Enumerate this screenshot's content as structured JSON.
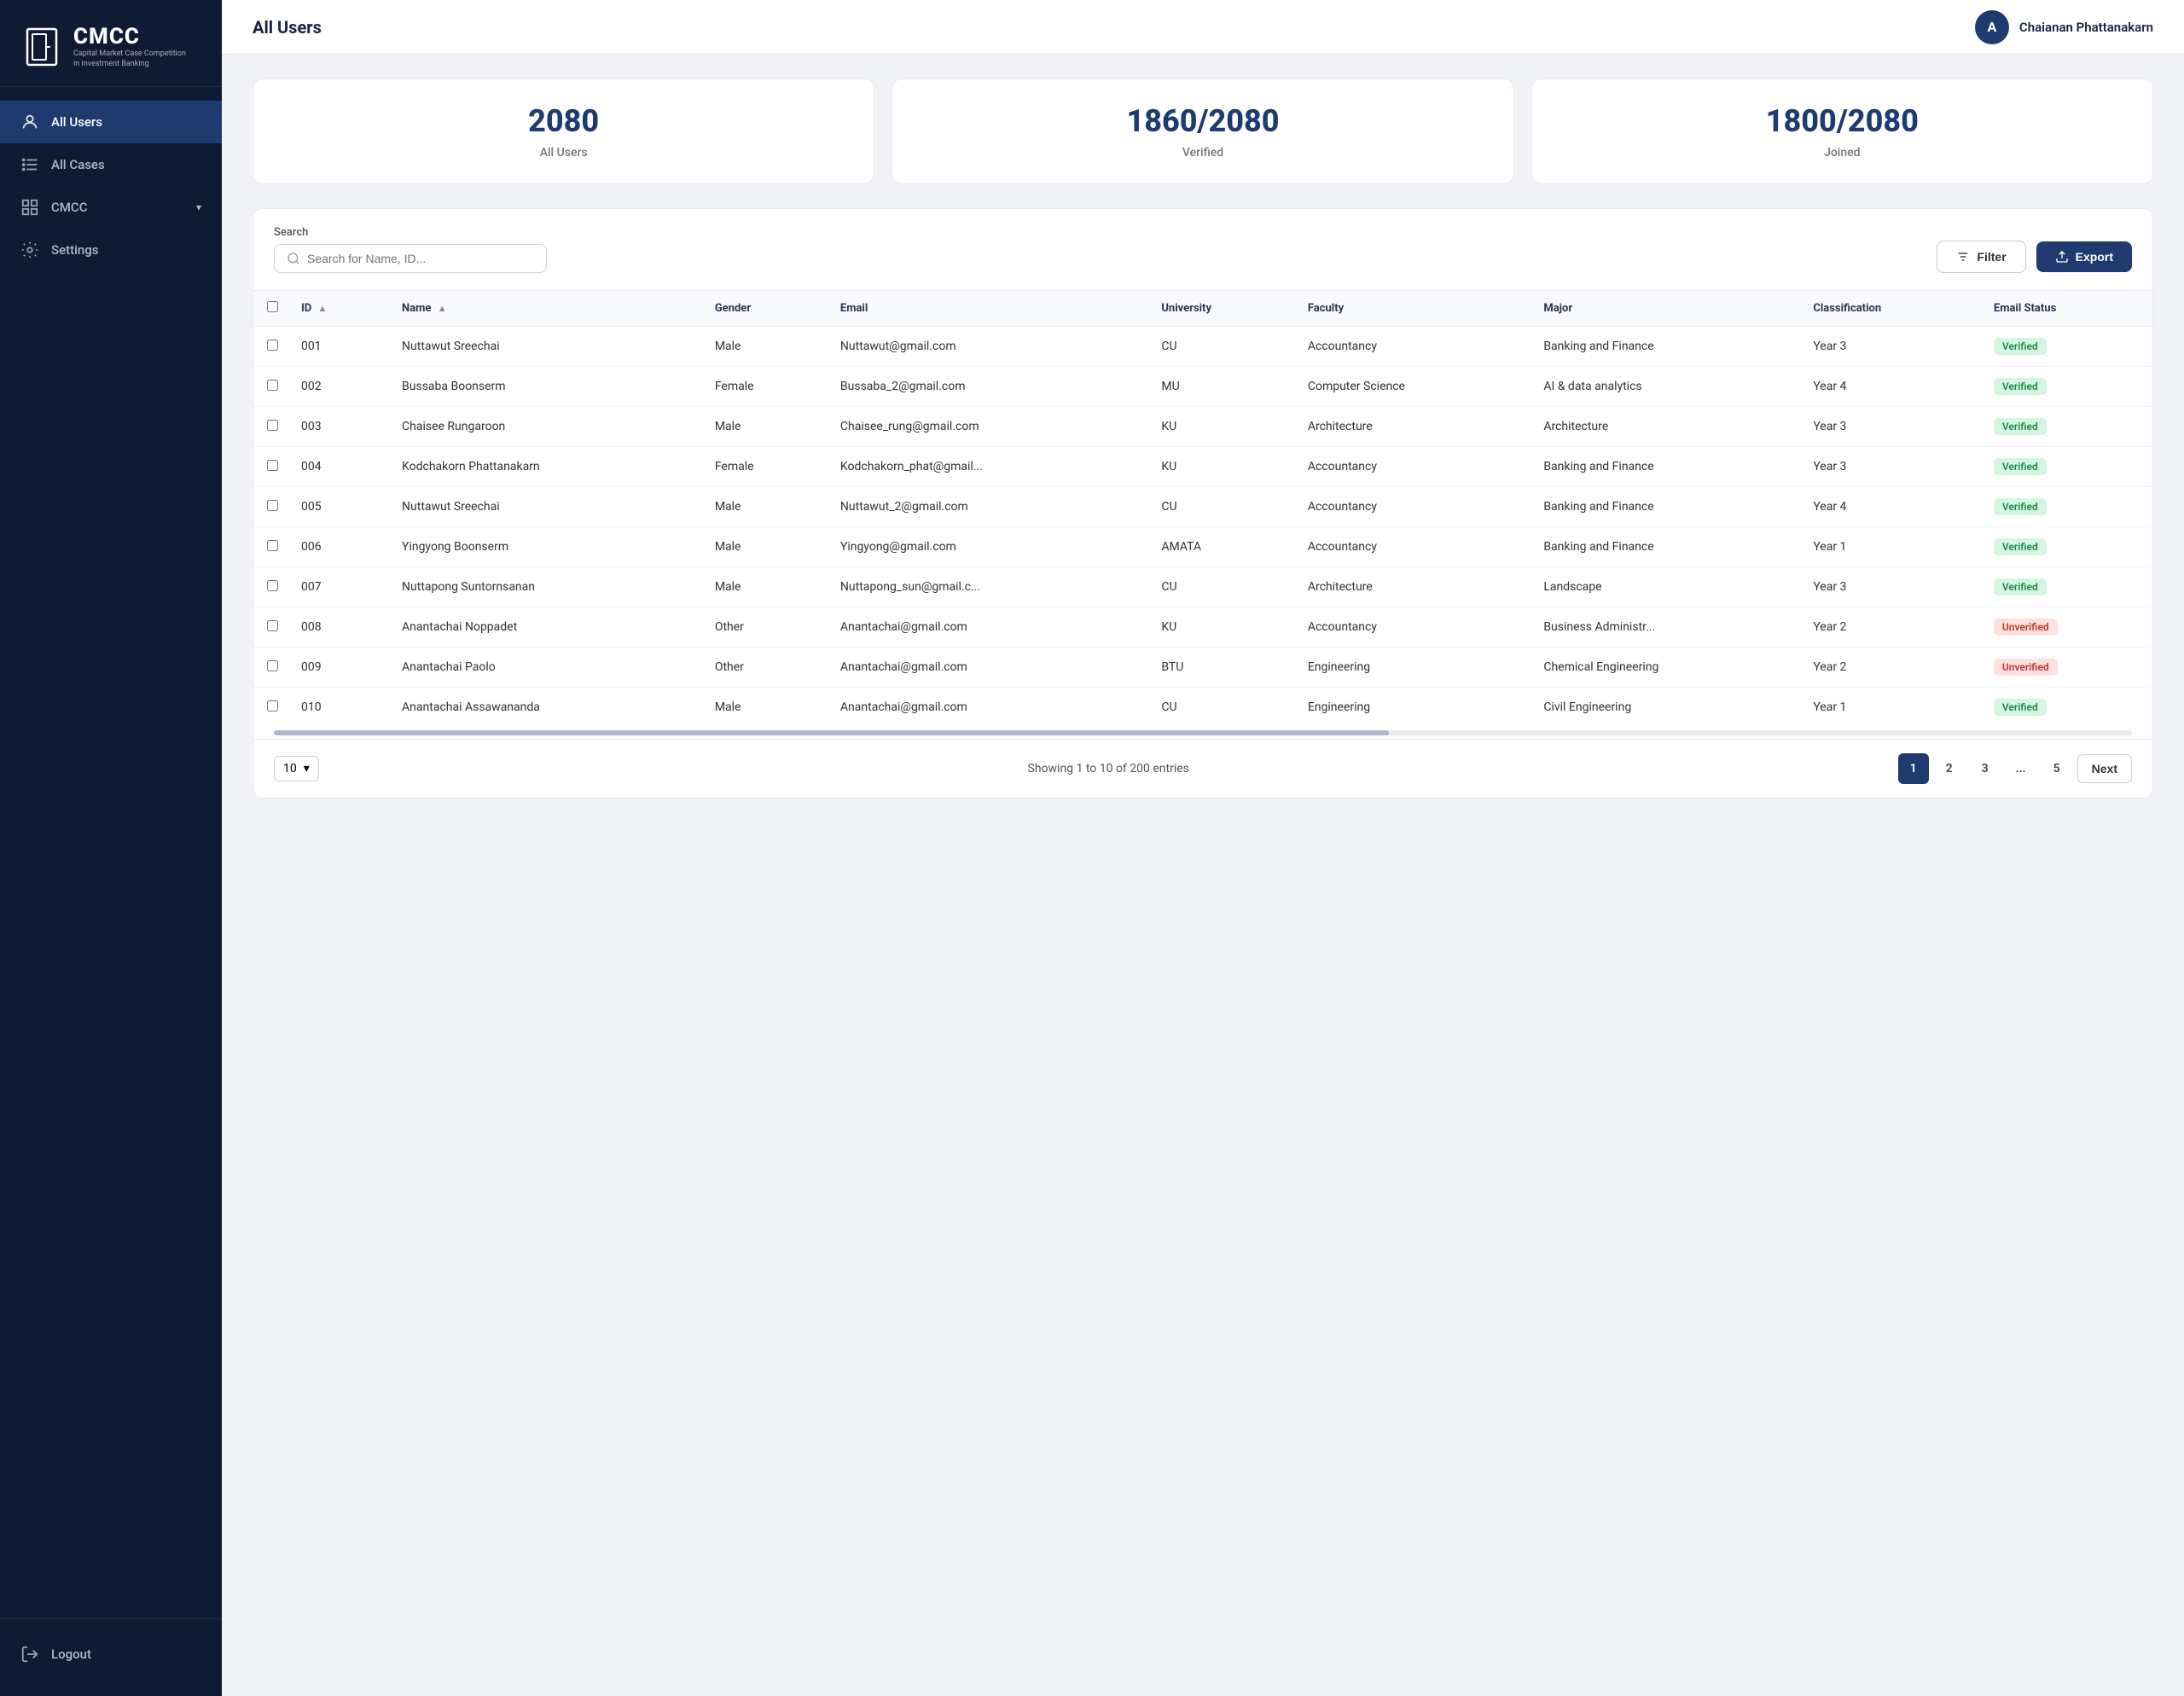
{
  "sidebar": {
    "logo": {
      "cmcc": "CMCC",
      "subtitle": "Capital Market Case Competition\nin Investment Banking"
    },
    "items": [
      {
        "id": "all-users",
        "label": "All Users",
        "icon": "user-icon",
        "active": true
      },
      {
        "id": "all-cases",
        "label": "All Cases",
        "icon": "list-icon",
        "active": false
      },
      {
        "id": "cmcc",
        "label": "CMCC",
        "icon": "grid-icon",
        "active": false,
        "hasArrow": true
      },
      {
        "id": "settings",
        "label": "Settings",
        "icon": "gear-icon",
        "active": false
      },
      {
        "id": "logout",
        "label": "Logout",
        "icon": "logout-icon",
        "active": false
      }
    ]
  },
  "header": {
    "title": "All Users",
    "user": {
      "avatar_letter": "A",
      "name": "Chaianan Phattanakarn"
    }
  },
  "stats": [
    {
      "value": "2080",
      "label": "All Users"
    },
    {
      "value": "1860/2080",
      "label": "Verified"
    },
    {
      "value": "1800/2080",
      "label": "Joined"
    }
  ],
  "toolbar": {
    "search_label": "Search",
    "search_placeholder": "Search for Name, ID...",
    "filter_label": "Filter",
    "export_label": "Export"
  },
  "table": {
    "columns": [
      "",
      "ID",
      "Name",
      "Gender",
      "Email",
      "University",
      "Faculty",
      "Major",
      "Classification",
      "Email Status"
    ],
    "rows": [
      {
        "id": "001",
        "name": "Nuttawut Sreechai",
        "gender": "Male",
        "email": "Nuttawut@gmail.com",
        "university": "CU",
        "faculty": "Accountancy",
        "major": "Banking and Finance",
        "classification": "Year 3",
        "status": "Verified"
      },
      {
        "id": "002",
        "name": "Bussaba Boonserm",
        "gender": "Female",
        "email": "Bussaba_2@gmail.com",
        "university": "MU",
        "faculty": "Computer Science",
        "major": "AI & data analytics",
        "classification": "Year 4",
        "status": "Verified"
      },
      {
        "id": "003",
        "name": "Chaisee Rungaroon",
        "gender": "Male",
        "email": "Chaisee_rung@gmail.com",
        "university": "KU",
        "faculty": "Architecture",
        "major": "Architecture",
        "classification": "Year 3",
        "status": "Verified"
      },
      {
        "id": "004",
        "name": "Kodchakorn Phattanakarn",
        "gender": "Female",
        "email": "Kodchakorn_phat@gmail...",
        "university": "KU",
        "faculty": "Accountancy",
        "major": "Banking and Finance",
        "classification": "Year 3",
        "status": "Verified"
      },
      {
        "id": "005",
        "name": "Nuttawut Sreechai",
        "gender": "Male",
        "email": "Nuttawut_2@gmail.com",
        "university": "CU",
        "faculty": "Accountancy",
        "major": "Banking and Finance",
        "classification": "Year 4",
        "status": "Verified"
      },
      {
        "id": "006",
        "name": "Yingyong Boonserm",
        "gender": "Male",
        "email": "Yingyong@gmail.com",
        "university": "AMATA",
        "faculty": "Accountancy",
        "major": "Banking and Finance",
        "classification": "Year 1",
        "status": "Verified"
      },
      {
        "id": "007",
        "name": "Nuttapong Suntornsanan",
        "gender": "Male",
        "email": "Nuttapong_sun@gmail.c...",
        "university": "CU",
        "faculty": "Architecture",
        "major": "Landscape",
        "classification": "Year 3",
        "status": "Verified"
      },
      {
        "id": "008",
        "name": "Anantachai Noppadet",
        "gender": "Other",
        "email": "Anantachai@gmail.com",
        "university": "KU",
        "faculty": "Accountancy",
        "major": "Business Administr...",
        "classification": "Year 2",
        "status": "Unverified"
      },
      {
        "id": "009",
        "name": "Anantachai Paolo",
        "gender": "Other",
        "email": "Anantachai@gmail.com",
        "university": "BTU",
        "faculty": "Engineering",
        "major": "Chemical Engineering",
        "classification": "Year 2",
        "status": "Unverified"
      },
      {
        "id": "010",
        "name": "Anantachai Assawananda",
        "gender": "Male",
        "email": "Anantachai@gmail.com",
        "university": "CU",
        "faculty": "Engineering",
        "major": "Civil Engineering",
        "classification": "Year 1",
        "status": "Verified"
      }
    ]
  },
  "pagination": {
    "page_size": "10",
    "showing_text": "Showing 1 to 10 of 200 entries",
    "pages": [
      "1",
      "2",
      "3",
      "...",
      "5"
    ],
    "next_label": "Next",
    "active_page": "1"
  }
}
